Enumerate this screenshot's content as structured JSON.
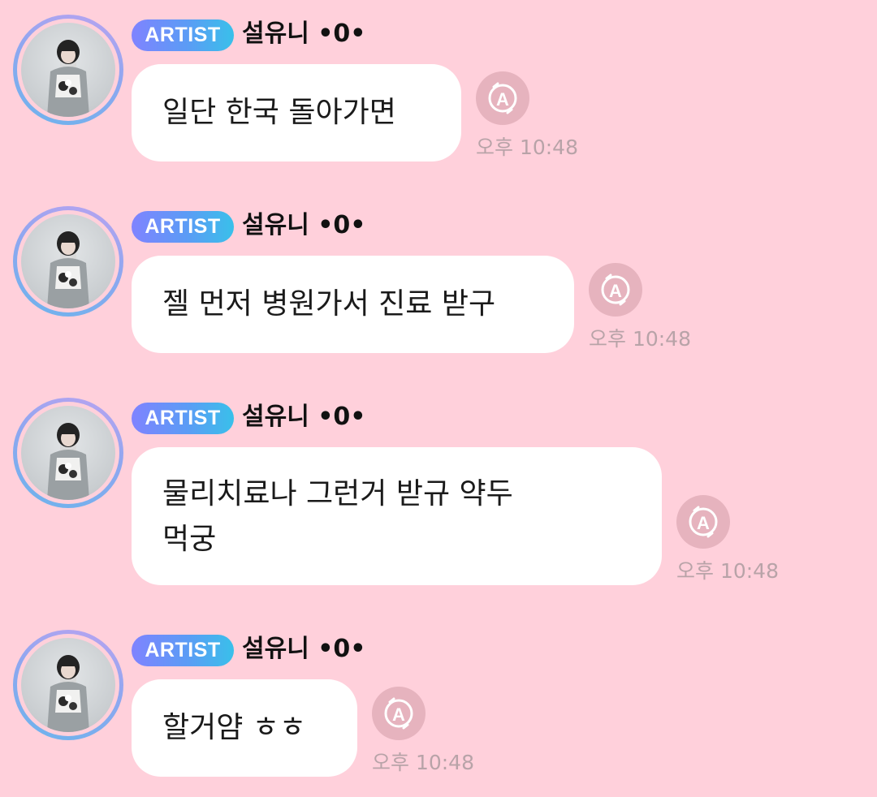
{
  "theme": {
    "background": "#ffd0db",
    "bubble": "#ffffff",
    "badge_gradient": [
      "#7f83ff",
      "#39c0ea"
    ],
    "avatar_ring": [
      "#bba3f0",
      "#6cb4ec"
    ],
    "timestamp_color": "#b8a3a8",
    "translate_button": "#e6b3be"
  },
  "messages": [
    {
      "badge": "ARTIST",
      "sender": "설유니 •0•",
      "text": "일단 한국 돌아가면",
      "time": "오후 10:48",
      "translate_icon": "translate-a-icon"
    },
    {
      "badge": "ARTIST",
      "sender": "설유니 •0•",
      "text": "젤 먼저 병원가서 진료 받구",
      "time": "오후 10:48",
      "translate_icon": "translate-a-icon"
    },
    {
      "badge": "ARTIST",
      "sender": "설유니 •0•",
      "text": "물리치료나 그런거 받규 약두\n먹궁",
      "time": "오후 10:48",
      "translate_icon": "translate-a-icon"
    },
    {
      "badge": "ARTIST",
      "sender": "설유니 •0•",
      "text": "할거얌 ㅎㅎ",
      "time": "오후 10:48",
      "translate_icon": "translate-a-icon"
    }
  ]
}
